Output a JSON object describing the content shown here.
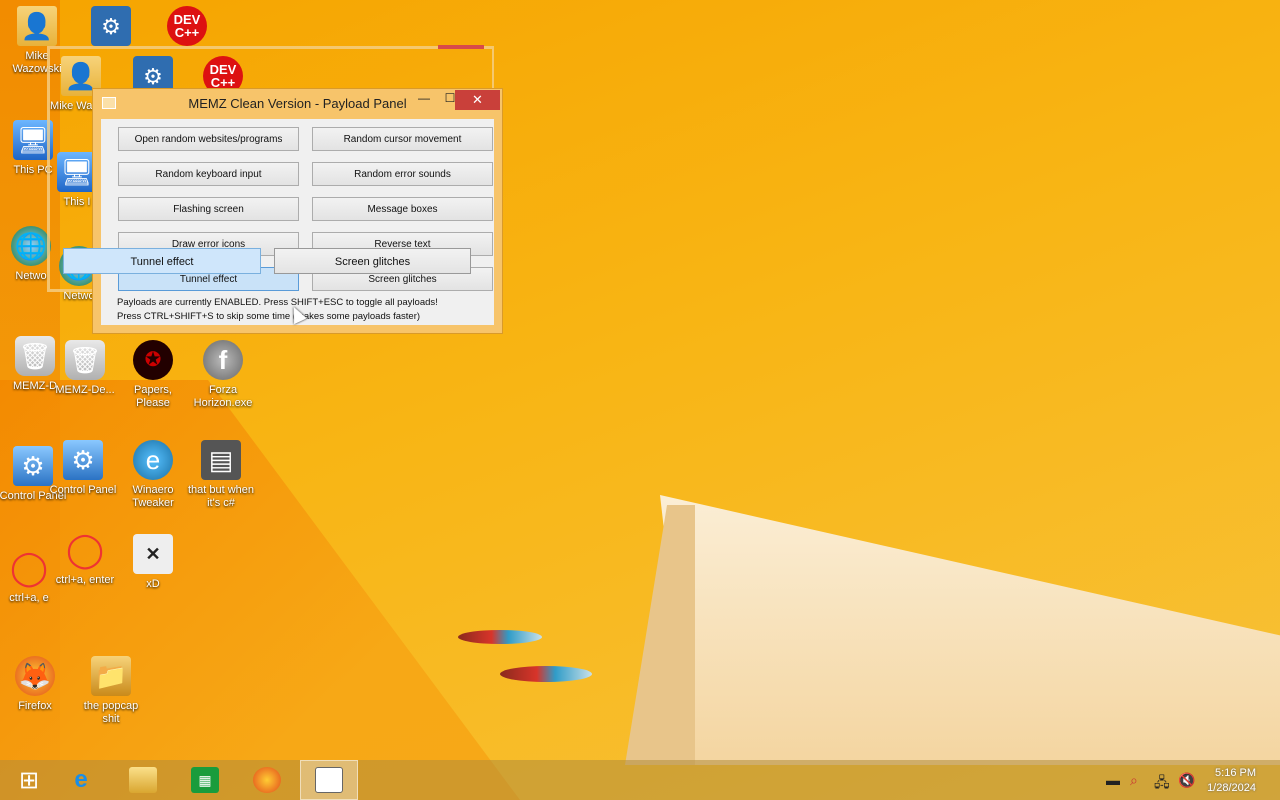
{
  "window": {
    "title": "MEMZ Clean Version - Payload Panel",
    "minimize_glyph": "—",
    "maximize_glyph": "☐",
    "close_glyph": "✕"
  },
  "payloads": {
    "open_random": "Open random websites/programs",
    "random_cursor": "Random cursor movement",
    "keyboard_input": "Random keyboard input",
    "error_sounds": "Random error sounds",
    "flashing_screen": "Flashing screen",
    "message_boxes": "Message boxes",
    "draw_error_icons": "Draw error icons",
    "reverse_text": "Reverse text",
    "tunnel_effect": "Tunnel effect",
    "screen_glitches": "Screen glitches"
  },
  "status": {
    "line1": "Payloads are currently ENABLED. Press SHIFT+ESC to toggle all payloads!",
    "line2": "Press CTRL+SHIFT+S to skip some time (makes some payloads faster)"
  },
  "glitch": {
    "tunnel": "Tunnel effect",
    "screen": "Screen glitches"
  },
  "desktop": {
    "mike_wazowski": "Mike Wazowski",
    "mike_wazowski_2": "Mike Wazow",
    "this_pc": "This PC",
    "this_pc_2": "This I",
    "network": "Netwo",
    "network_2": "Netwo",
    "memz_1": "MEMZ-D",
    "memz_2": "MEMZ-De...",
    "papers_please": "Papers, Please",
    "forza": "Forza Horizon.exe",
    "control_panel": "Control Panel",
    "control_panel_2": "Control Panel",
    "winaero": "Winaero Tweaker",
    "that_but": "that but when it's c#",
    "ctrl_a_enter": "ctrl+a, enter",
    "ctrl_a_enter_2": "ctrl+a, e",
    "hxd": "xD",
    "firefox": "Firefox",
    "popcap": "the popcap shit",
    "dev_glyph": "DEV C++"
  },
  "taskbar": {
    "time": "5:16 PM",
    "date": "1/28/2024"
  },
  "colors": {
    "wallpaper": "#f8b514",
    "close_button": "#c9403a",
    "active_button": "#c9e2f8"
  }
}
